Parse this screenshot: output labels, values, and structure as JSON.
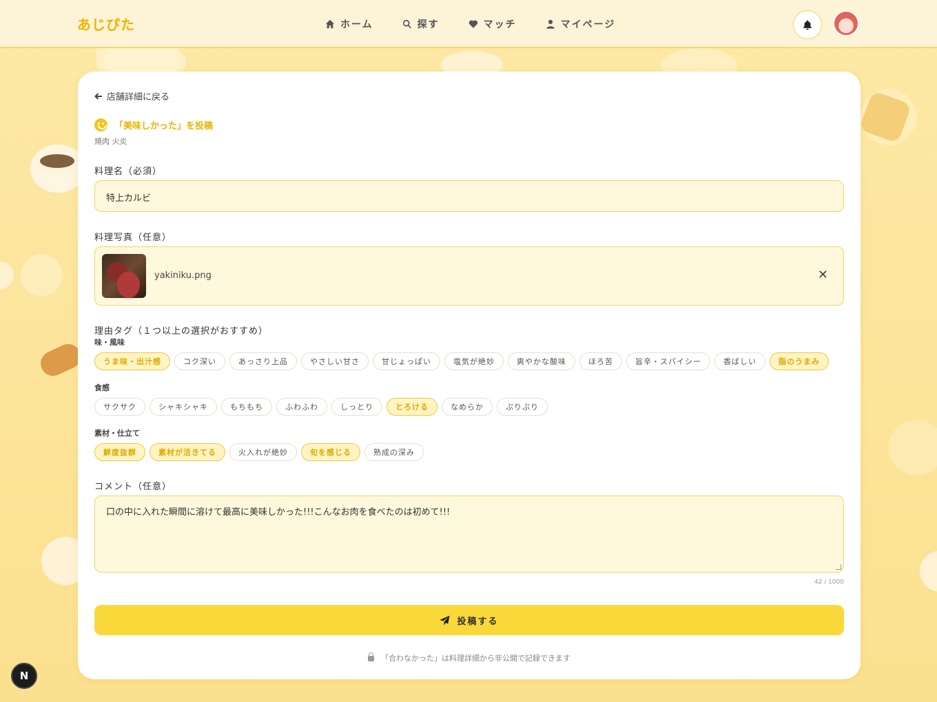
{
  "header": {
    "logo": "あじぴた",
    "nav": [
      {
        "label": "ホーム",
        "icon": "home-icon"
      },
      {
        "label": "探す",
        "icon": "search-icon"
      },
      {
        "label": "マッチ",
        "icon": "heart-icon"
      },
      {
        "label": "マイページ",
        "icon": "user-icon"
      }
    ]
  },
  "form": {
    "back_label": "店舗詳細に戻る",
    "title": "「美味しかった」を投稿",
    "shop_name": "焼肉 火炎",
    "dish_label": "料理名（必須）",
    "dish_value": "特上カルビ",
    "photo_label": "料理写真（任意）",
    "photo_filename": "yakiniku.png",
    "remove_symbol": "✕",
    "tags_label": "理由タグ（１つ以上の選択がおすすめ）",
    "tag_groups": [
      {
        "name": "味・風味",
        "tags": [
          {
            "label": "うま味・出汁感",
            "selected": true
          },
          {
            "label": "コク深い",
            "selected": false
          },
          {
            "label": "あっさり上品",
            "selected": false
          },
          {
            "label": "やさしい甘さ",
            "selected": false
          },
          {
            "label": "甘じょっぱい",
            "selected": false
          },
          {
            "label": "塩気が絶妙",
            "selected": false
          },
          {
            "label": "爽やかな酸味",
            "selected": false
          },
          {
            "label": "ほろ苦",
            "selected": false
          },
          {
            "label": "旨辛・スパイシー",
            "selected": false
          },
          {
            "label": "香ばしい",
            "selected": false
          },
          {
            "label": "脂のうまみ",
            "selected": true
          }
        ]
      },
      {
        "name": "食感",
        "tags": [
          {
            "label": "サクサク",
            "selected": false
          },
          {
            "label": "シャキシャキ",
            "selected": false
          },
          {
            "label": "もちもち",
            "selected": false
          },
          {
            "label": "ふわふわ",
            "selected": false
          },
          {
            "label": "しっとり",
            "selected": false
          },
          {
            "label": "とろける",
            "selected": true
          },
          {
            "label": "なめらか",
            "selected": false
          },
          {
            "label": "ぷりぷり",
            "selected": false
          }
        ]
      },
      {
        "name": "素材・仕立て",
        "tags": [
          {
            "label": "鮮度抜群",
            "selected": true
          },
          {
            "label": "素材が活きてる",
            "selected": true
          },
          {
            "label": "火入れが絶妙",
            "selected": false
          },
          {
            "label": "旬を感じる",
            "selected": true
          },
          {
            "label": "熟成の深み",
            "selected": false
          }
        ]
      }
    ],
    "comment_label": "コメント（任意）",
    "comment_value": "口の中に入れた瞬間に溶けて最高に美味しかった!!!こんなお肉を食べたのは初めて!!!",
    "counter": "42 / 1000",
    "submit_label": "投稿する",
    "note": "「合わなかった」は料理詳細から非公開で記録できます"
  },
  "dev_badge": "N",
  "colors": {
    "accent": "#f9d93a",
    "selected_chip_text": "#e0a800",
    "background": "#fce9a8"
  }
}
